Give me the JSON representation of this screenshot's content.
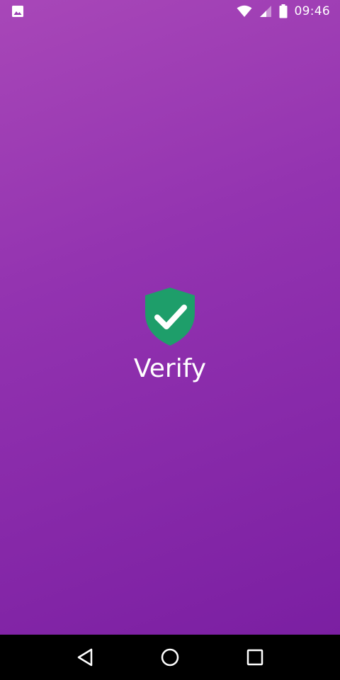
{
  "status_bar": {
    "time": "09:46",
    "icons": [
      "image-notification-icon",
      "wifi-icon",
      "signal-icon",
      "battery-icon"
    ]
  },
  "brand": {
    "title": "Verify",
    "logo_icon": "shield-check-icon",
    "logo_color": "#1e9e6a"
  },
  "colors": {
    "background_top": "#a847b8",
    "background_bottom": "#7b1fa2",
    "nav_bar": "#000000",
    "text": "#ffffff"
  },
  "nav_bar": {
    "buttons": [
      "back-icon",
      "home-icon",
      "recents-icon"
    ]
  }
}
